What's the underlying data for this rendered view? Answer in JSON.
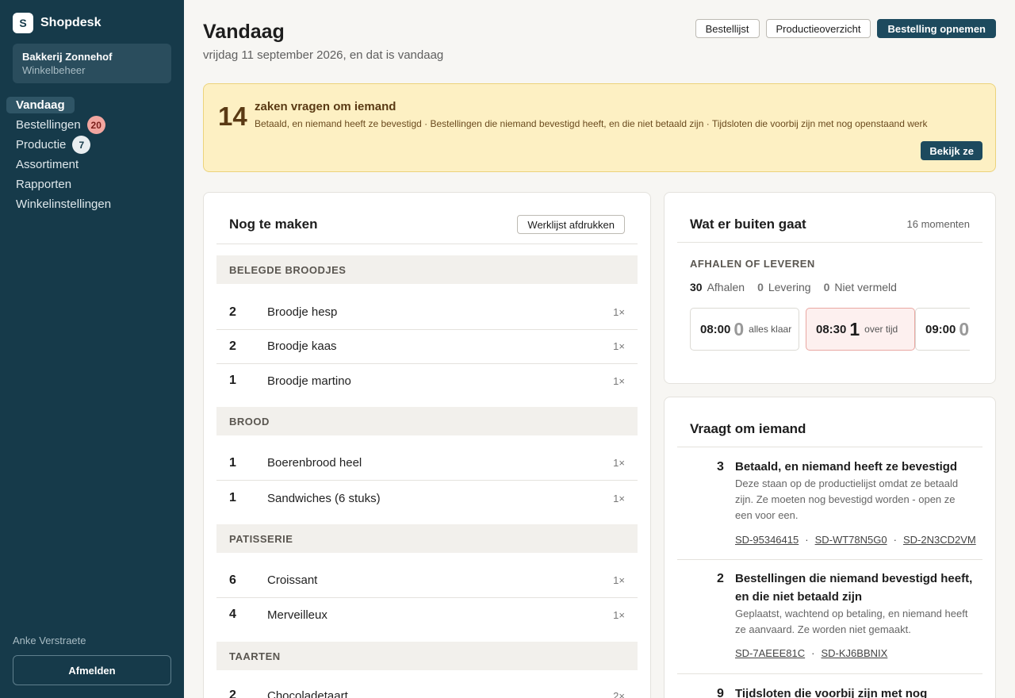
{
  "sidebar": {
    "brand": {
      "logo_letter": "S",
      "name": "Shopdesk"
    },
    "shop": {
      "name": "Bakkerij Zonnehof",
      "subtitle": "Winkelbeheer"
    },
    "nav": [
      {
        "label": "Vandaag",
        "active": true
      },
      {
        "label": "Bestellingen",
        "badge": "20"
      },
      {
        "label": "Productie",
        "badge": "7"
      },
      {
        "label": "Assortiment"
      },
      {
        "label": "Rapporten"
      },
      {
        "label": "Winkelinstellingen"
      }
    ],
    "user": "Anke Verstraete",
    "logout_label": "Afmelden"
  },
  "header": {
    "title": "Vandaag",
    "subtitle": "vrijdag 11 september 2026, en dat is vandaag",
    "actions": {
      "order_list": "Bestellijst",
      "production": "Productieoverzicht",
      "new_order": "Bestelling opnemen"
    }
  },
  "alert": {
    "count": "14",
    "title": "zaken vragen om iemand",
    "description": "Betaald, en niemand heeft ze bevestigd · Bestellingen die niemand bevestigd heeft, en die niet betaald zijn · Tijdsloten die voorbij zijn met nog openstaand werk",
    "button": "Bekijk ze"
  },
  "make": {
    "title": "Nog te maken",
    "print_button": "Werklijst afdrukken",
    "groups": [
      {
        "name": "BELEGDE BROODJES",
        "items": [
          {
            "qty": "2",
            "name": "Broodje hesp",
            "mult": "1×"
          },
          {
            "qty": "2",
            "name": "Broodje kaas",
            "mult": "1×"
          },
          {
            "qty": "1",
            "name": "Broodje martino",
            "mult": "1×"
          }
        ]
      },
      {
        "name": "BROOD",
        "items": [
          {
            "qty": "1",
            "name": "Boerenbrood heel",
            "mult": "1×"
          },
          {
            "qty": "1",
            "name": "Sandwiches (6 stuks)",
            "mult": "1×"
          }
        ]
      },
      {
        "name": "PATISSERIE",
        "items": [
          {
            "qty": "6",
            "name": "Croissant",
            "mult": "1×"
          },
          {
            "qty": "4",
            "name": "Merveilleux",
            "mult": "1×"
          }
        ]
      },
      {
        "name": "TAARTEN",
        "items": [
          {
            "qty": "2",
            "name": "Chocoladetaart",
            "mult": "2×"
          }
        ]
      }
    ]
  },
  "out": {
    "title": "Wat er buiten gaat",
    "moments": "16 momenten",
    "subtitle": "AFHALEN OF LEVEREN",
    "stats": [
      {
        "num": "30",
        "label": "Afhalen"
      },
      {
        "num": "0",
        "label": "Levering"
      },
      {
        "num": "0",
        "label": "Niet vermeld"
      }
    ],
    "slots": [
      {
        "time": "08:00",
        "num": "0",
        "label": "alles klaar"
      },
      {
        "time": "08:30",
        "num": "1",
        "label": "over tijd",
        "late": true
      },
      {
        "time": "09:00",
        "num": "0",
        "label": ""
      }
    ]
  },
  "ask": {
    "title": "Vraagt om iemand",
    "items": [
      {
        "num": "3",
        "title": "Betaald, en niemand heeft ze bevestigd",
        "desc": "Deze staan op de productielijst omdat ze betaald zijn. Ze moeten nog bevestigd worden - open ze een voor een.",
        "refs": [
          "SD-95346415",
          "SD-WT78N5G0",
          "SD-2N3CD2VM"
        ]
      },
      {
        "num": "2",
        "title": "Bestellingen die niemand bevestigd heeft, en die niet betaald zijn",
        "desc": "Geplaatst, wachtend op betaling, en niemand heeft ze aanvaard. Ze worden niet gemaakt.",
        "refs": [
          "SD-7AEEE81C",
          "SD-KJ6BBNIX"
        ]
      },
      {
        "num": "9",
        "title": "Tijdsloten die voorbij zijn met nog"
      }
    ]
  }
}
